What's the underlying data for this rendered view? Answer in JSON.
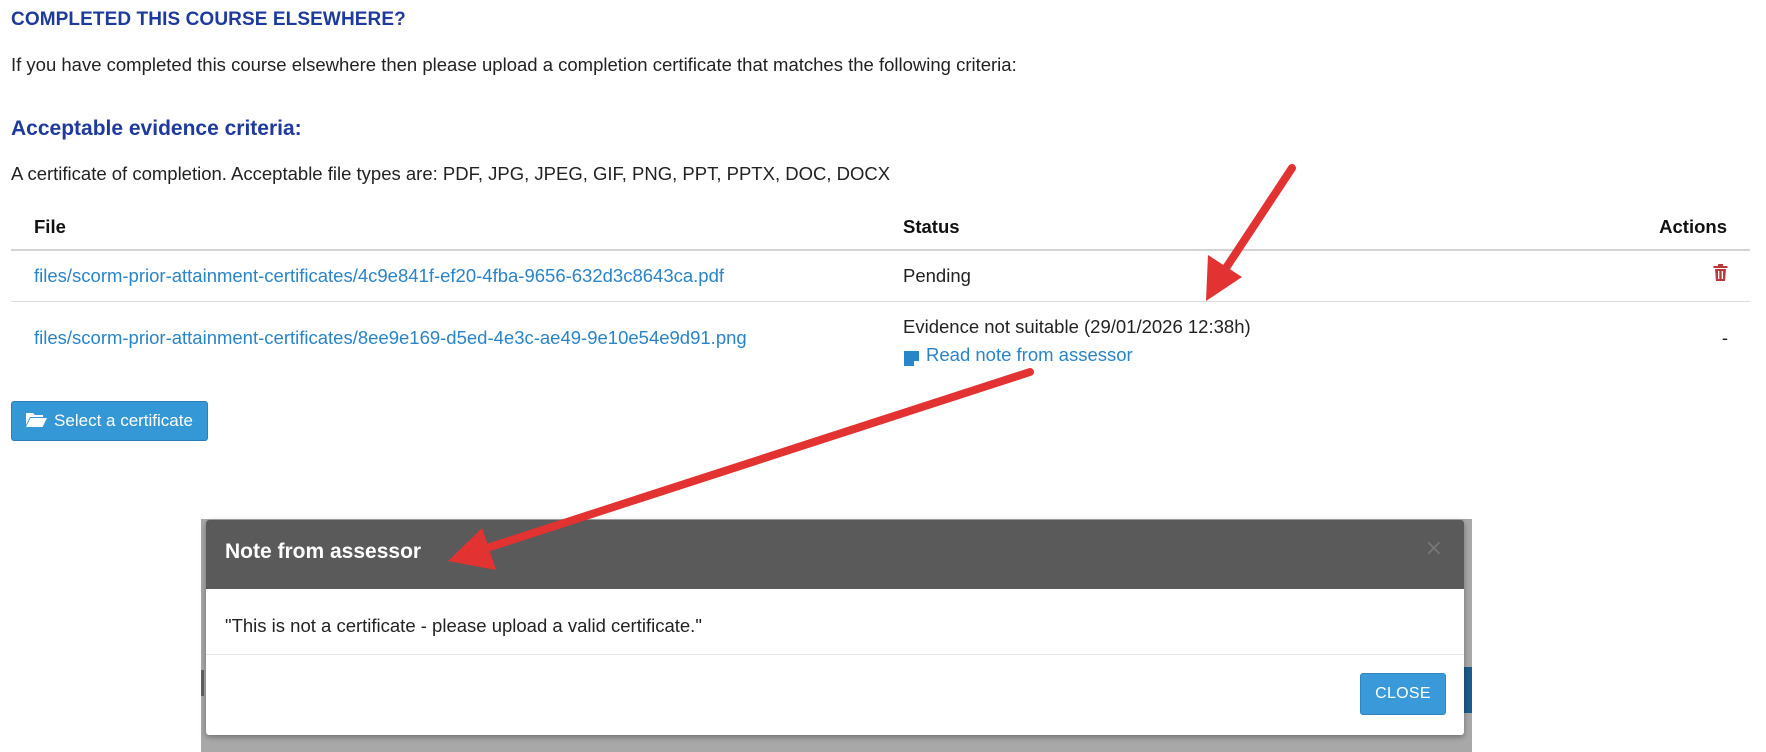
{
  "section": {
    "title": "COMPLETED THIS COURSE ELSEWHERE?",
    "intro": "If you have completed this course elsewhere then please upload a completion certificate that matches the following criteria:",
    "criteria_heading": "Acceptable evidence criteria:",
    "criteria_text": "A certificate of completion. Acceptable file types are: PDF, JPG, JPEG, GIF, PNG, PPT, PPTX, DOC, DOCX"
  },
  "table": {
    "headers": {
      "file": "File",
      "status": "Status",
      "actions": "Actions"
    },
    "rows": [
      {
        "file": "files/scorm-prior-attainment-certificates/4c9e841f-ef20-4fba-9656-632d3c8643ca.pdf",
        "status": "Pending",
        "action_icon": "trash-icon"
      },
      {
        "file": "files/scorm-prior-attainment-certificates/8ee9e169-d5ed-4e3c-ae49-9e10e54e9d91.png",
        "status": "Evidence not suitable (29/01/2026 12:38h)",
        "note_link": "Read note from assessor",
        "note_icon": "note-icon",
        "action_text": "-"
      }
    ]
  },
  "select_button": {
    "label": "Select a certificate",
    "icon": "folder-open-icon"
  },
  "modal": {
    "title": "Note from assessor",
    "close_x": "×",
    "body": "\"This is not a certificate - please upload a valid certificate.\"",
    "close_label": "CLOSE"
  },
  "colors": {
    "heading": "#1d3a9c",
    "link": "#2a84c9",
    "button": "#3497d6",
    "modal_header": "#5a5a5a",
    "trash": "#b83a3a",
    "annotation_arrow": "#e23232"
  }
}
